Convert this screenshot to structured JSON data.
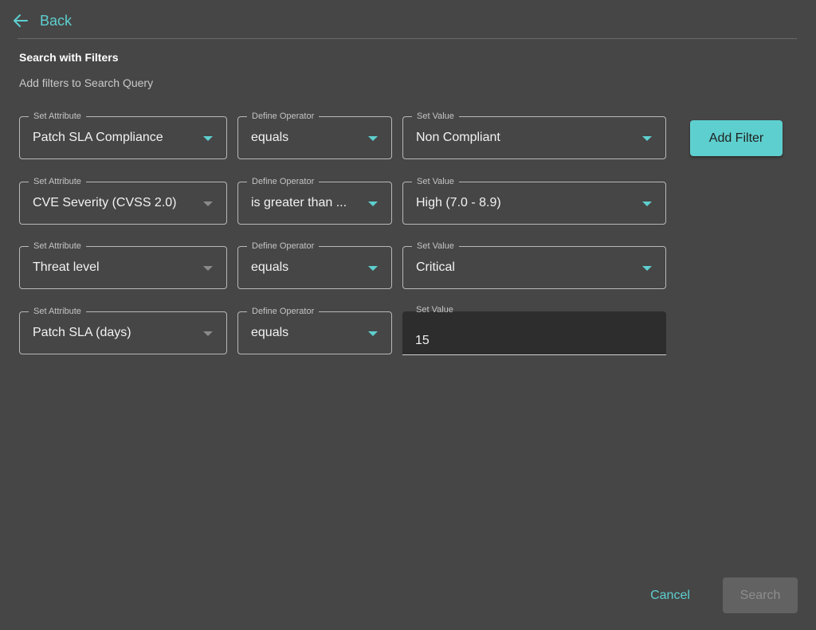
{
  "header": {
    "back_label": "Back"
  },
  "section": {
    "title": "Search with Filters",
    "subtitle": "Add filters to Search Query"
  },
  "labels": {
    "attribute": "Set Attribute",
    "operator": "Define Operator",
    "value": "Set Value"
  },
  "filters": [
    {
      "attribute": "Patch SLA Compliance",
      "operator": "equals",
      "value": "Non Compliant"
    },
    {
      "attribute": "CVE Severity (CVSS 2.0)",
      "operator": "is greater than ...",
      "value": "High (7.0 - 8.9)"
    },
    {
      "attribute": "Threat level",
      "operator": "equals",
      "value": "Critical"
    },
    {
      "attribute": "Patch SLA (days)",
      "operator": "equals",
      "value": "15"
    }
  ],
  "actions": {
    "add_filter_label": "Add Filter",
    "cancel_label": "Cancel",
    "search_label": "Search"
  },
  "colors": {
    "background": "#464646",
    "accent": "#5ecfcf",
    "input_filled_bg": "#2d2d2d",
    "disabled_button": "#626262"
  },
  "icons": {
    "back": "arrow-left-icon",
    "dropdown": "caret-down-icon"
  }
}
